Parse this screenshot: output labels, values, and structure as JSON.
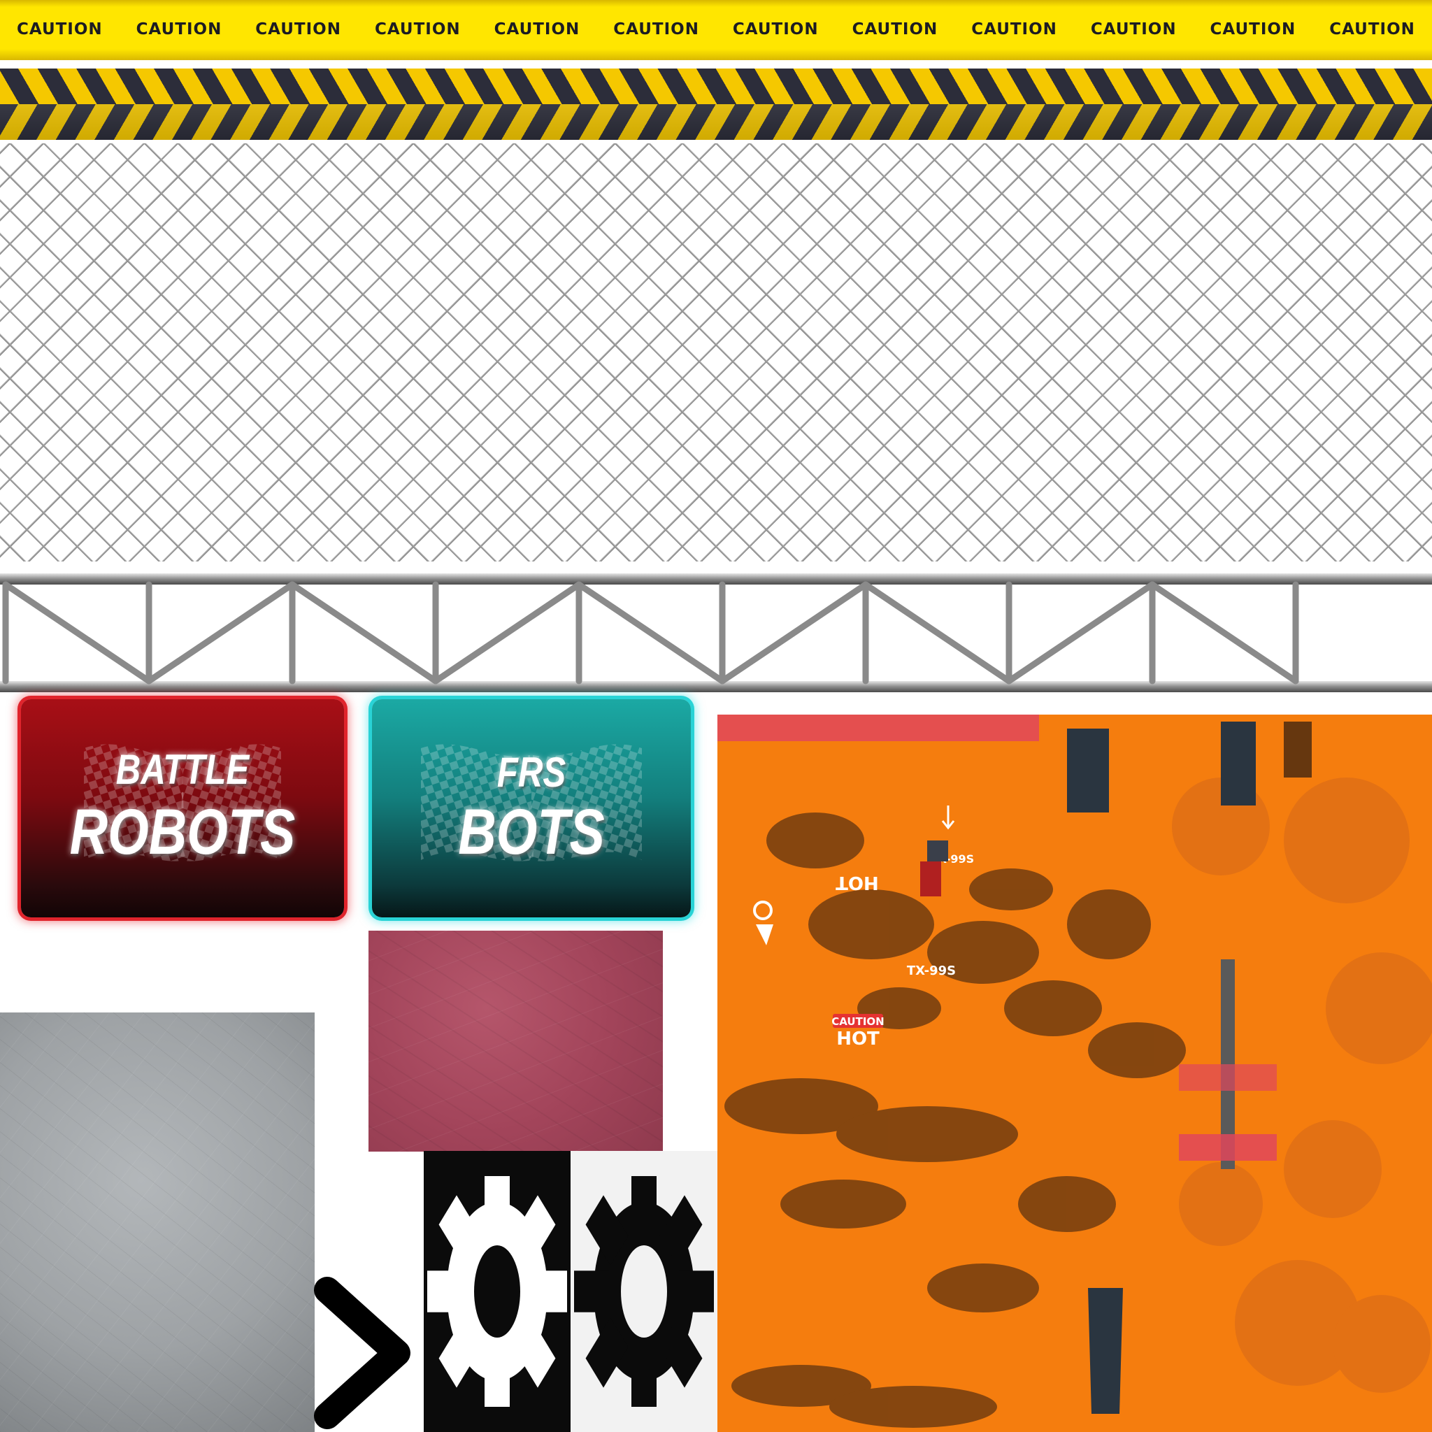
{
  "caution_tape": {
    "label": "CAUTION",
    "repeats": [
      "CAUTION",
      "CAUTION",
      "CAUTION",
      "CAUTION",
      "CAUTION",
      "CAUTION",
      "CAUTION",
      "CAUTION",
      "CAUTION",
      "CAUTION",
      "CAUTION",
      "CAUTION"
    ]
  },
  "banners": {
    "battle": {
      "line1": "BATTLE",
      "line2": "ROBOTS"
    },
    "frs": {
      "line1": "FRS",
      "line2": "BOTS"
    }
  },
  "atlas_decals": {
    "decal_1": "CAUTION",
    "decal_2": "HOT",
    "decal_3": "TX-99S",
    "decal_4": "TX-99S"
  },
  "colors": {
    "caution_yellow": "#ffe600",
    "stripe_dark": "#2c2d3a",
    "battle_red": "#e0242c",
    "frs_teal": "#29d3d6",
    "atlas_orange": "#f57d0e",
    "pink_metal": "#a2445a",
    "grey_metal": "#9ea2a5"
  },
  "icons": {
    "chevron": "chevron-right-icon",
    "gear_white": "gear-icon",
    "gear_black": "gear-icon"
  }
}
